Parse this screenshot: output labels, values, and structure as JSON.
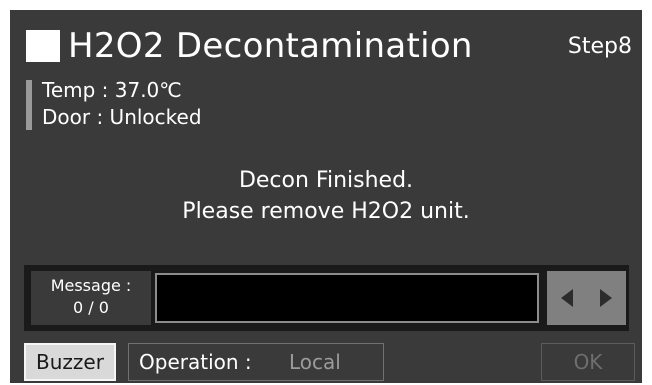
{
  "header": {
    "title": "H2O2 Decontamination",
    "step": "Step8"
  },
  "status": {
    "temp_line": "Temp : 37.0℃",
    "door_line": "Door  : Unlocked"
  },
  "main": {
    "line1": "Decon Finished.",
    "line2": "Please remove H2O2 unit."
  },
  "message_panel": {
    "label": "Message :",
    "counter": "0 / 0",
    "text": ""
  },
  "footer": {
    "buzzer_label": "Buzzer",
    "operation_label": "Operation :",
    "operation_value": "Local",
    "ok_label": "OK"
  },
  "icons": {
    "prev": "triangle-left-icon",
    "next": "triangle-right-icon",
    "title_marker": "white-square-icon"
  },
  "colors": {
    "screen_bg": "#3a3a3a",
    "panel_bg": "#1a1a1a",
    "button_gray": "#808080",
    "disabled_text": "#6e6e6e"
  }
}
